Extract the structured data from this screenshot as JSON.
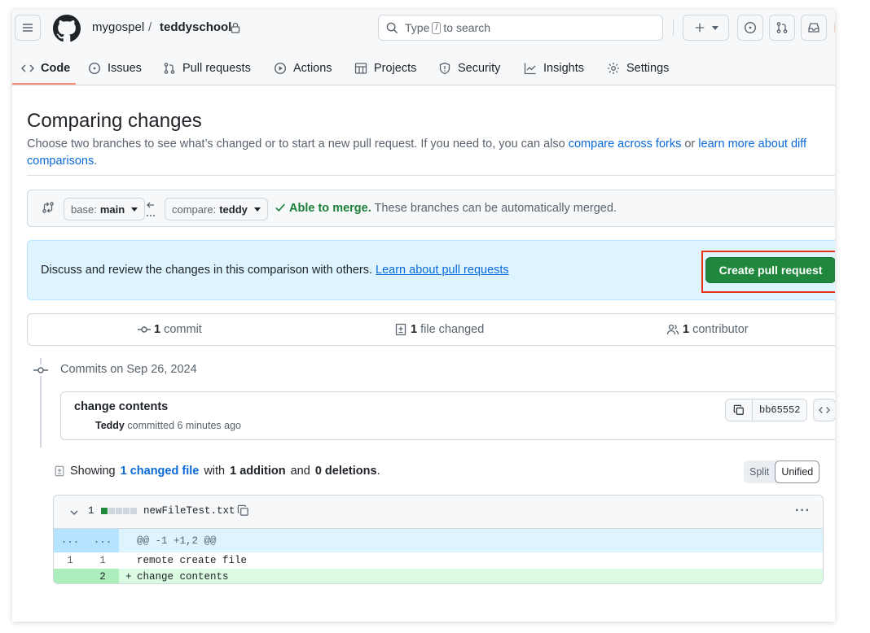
{
  "header": {
    "owner": "mygospel",
    "separator": "/",
    "repo": "teddyschool",
    "search": {
      "prefix": "Type",
      "key": "/",
      "suffix": "to search"
    }
  },
  "tabs": [
    {
      "label": "Code",
      "icon": "code-icon",
      "active": true
    },
    {
      "label": "Issues",
      "icon": "issue-icon"
    },
    {
      "label": "Pull requests",
      "icon": "pull-request-icon"
    },
    {
      "label": "Actions",
      "icon": "play-icon"
    },
    {
      "label": "Projects",
      "icon": "table-icon"
    },
    {
      "label": "Security",
      "icon": "shield-icon"
    },
    {
      "label": "Insights",
      "icon": "graph-icon"
    },
    {
      "label": "Settings",
      "icon": "gear-icon"
    }
  ],
  "page": {
    "title": "Comparing changes",
    "desc_before": "Choose two branches to see what’s changed or to start a new pull request. If you need to, you can also ",
    "link_forks": "compare across forks",
    "desc_or": " or ",
    "link_learn": "learn more about diff comparisons",
    "desc_end": "."
  },
  "range": {
    "base_prefix": "base:",
    "base_value": "main",
    "compare_prefix": "compare:",
    "compare_value": "teddy",
    "merge_strong": "Able to merge.",
    "merge_text": " These branches can be automatically merged."
  },
  "blankslate": {
    "text": "Discuss and review the changes in this comparison with others. ",
    "link": "Learn about pull requests",
    "button": "Create pull request"
  },
  "stats": {
    "commits_count": "1",
    "commits_label": " commit",
    "files_count": "1",
    "files_label": " file changed",
    "contributors_count": "1",
    "contributors_label": " contributor"
  },
  "commits": {
    "date_label": "Commits on Sep 26, 2024",
    "title": "change contents",
    "author": "Teddy",
    "meta": " committed 6 minutes ago",
    "sha": "bb65552"
  },
  "summary": {
    "showing": "Showing",
    "changed_files": "1 changed file",
    "with": "with",
    "additions": "1 addition",
    "and": "and",
    "deletions": "0 deletions",
    "end": ".",
    "split": "Split",
    "unified": "Unified"
  },
  "diff": {
    "count": "1",
    "filename": "newFileTest.txt",
    "more": "···",
    "hunk_left": "...",
    "hunk_right": "...",
    "hunk": "@@ -1 +1,2 @@",
    "lines": [
      {
        "old": "1",
        "new": "1",
        "marker": " ",
        "text": "remote create file"
      },
      {
        "old": "",
        "new": "2",
        "marker": "+",
        "text": "change contents"
      }
    ]
  }
}
